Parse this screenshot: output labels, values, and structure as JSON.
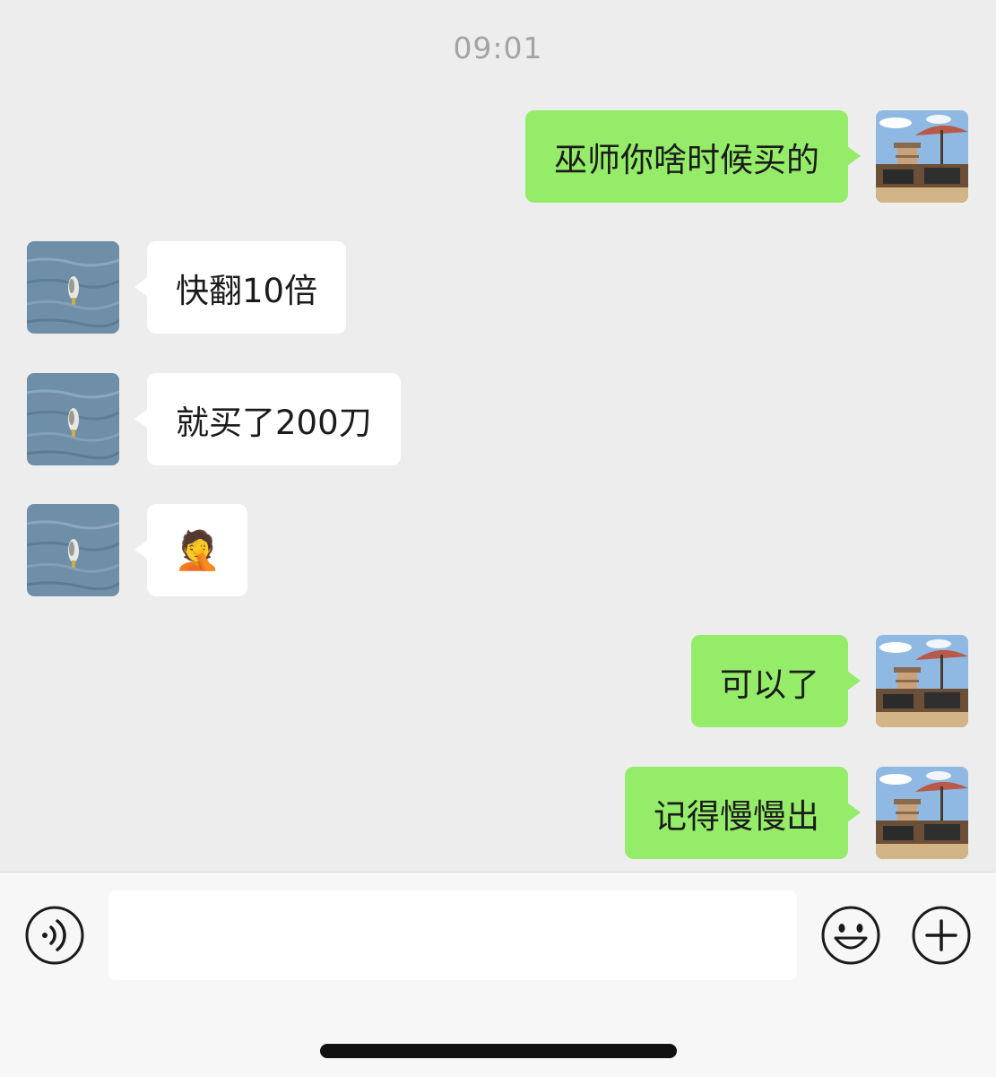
{
  "chat": {
    "timestamp": "09:01",
    "messages": [
      {
        "direction": "out",
        "text": "巫师你啥时候买的"
      },
      {
        "direction": "in",
        "text": "快翻10倍"
      },
      {
        "direction": "in",
        "text": "就买了200刀"
      },
      {
        "direction": "in",
        "text": "🤦"
      },
      {
        "direction": "out",
        "text": "可以了"
      },
      {
        "direction": "out",
        "text": "记得慢慢出"
      }
    ]
  },
  "input_bar": {
    "voice_icon": "voice-icon",
    "emoji_icon": "emoji-smile-icon",
    "more_icon": "plus-circle-icon",
    "placeholder": ""
  },
  "colors": {
    "background": "#ededed",
    "outgoing_bubble": "#95ec69",
    "incoming_bubble": "#ffffff",
    "timestamp_text": "#a3a3a3"
  }
}
